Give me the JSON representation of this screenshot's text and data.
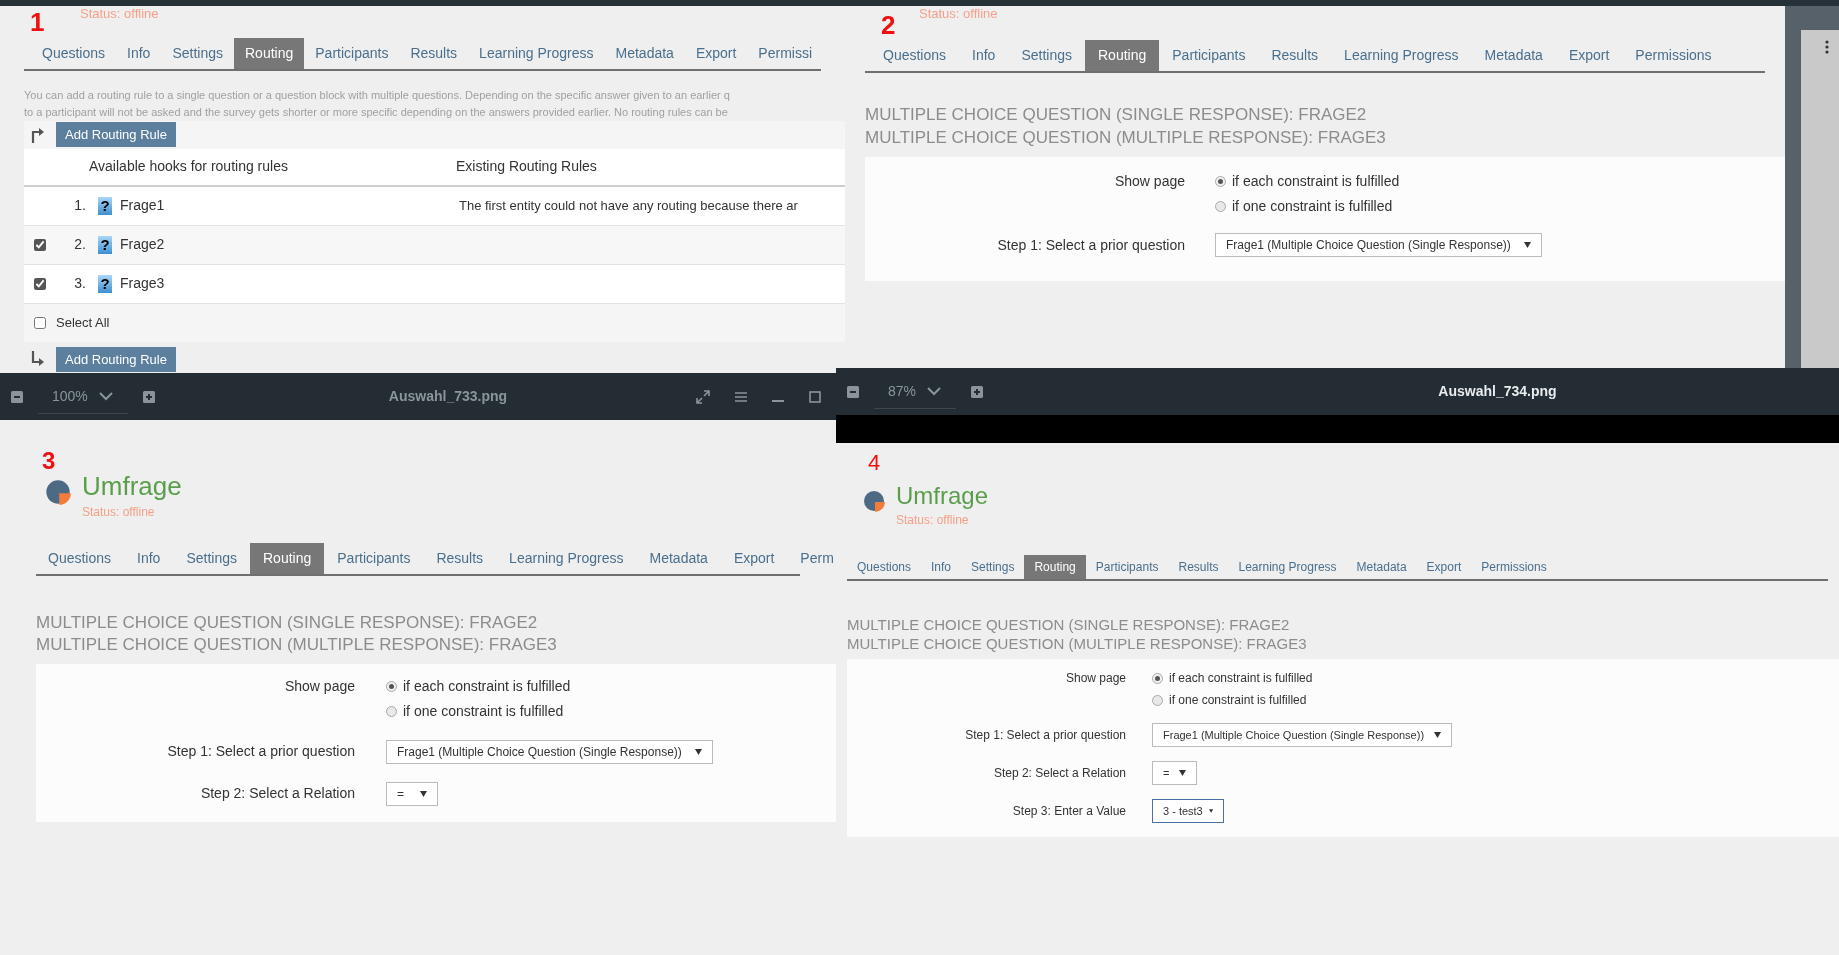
{
  "panels": [
    {
      "kind": "routing_list",
      "number": "1",
      "header": {
        "status": "Status: offline"
      },
      "tabs": [
        {
          "label": "Questions",
          "selected": false
        },
        {
          "label": "Info",
          "selected": false
        },
        {
          "label": "Settings",
          "selected": false
        },
        {
          "label": "Routing",
          "selected": true
        },
        {
          "label": "Participants",
          "selected": false
        },
        {
          "label": "Results",
          "selected": false
        },
        {
          "label": "Learning Progress",
          "selected": false
        },
        {
          "label": "Metadata",
          "selected": false
        },
        {
          "label": "Export",
          "selected": false
        },
        {
          "label": "Permissi",
          "selected": false
        }
      ],
      "intro": [
        "You can add a routing rule to a single question or a question block with multiple questions. Depending on the specific answer given to an earlier q",
        "to a participant will not be asked and the survey gets shorter or more specific depending on the answers provided earlier. No routing rules can be"
      ],
      "add_button": "Add Routing Rule",
      "columns": [
        "Available hooks for routing rules",
        "Existing Routing Rules"
      ],
      "rows": [
        {
          "kind": "fixed",
          "index": "1.",
          "icon": "?",
          "name": "Frage1",
          "rule": "The first entity could not have any routing because there ar"
        },
        {
          "kind": "selectable",
          "checked": true,
          "index": "2.",
          "icon": "?",
          "name": "Frage2"
        },
        {
          "kind": "selectable",
          "checked": true,
          "index": "3.",
          "icon": "?",
          "name": "Frage3"
        }
      ],
      "select_all": {
        "label": "Select All",
        "checked": false
      },
      "add_button_bottom": "Add Routing Rule"
    },
    {
      "kind": "routing_form",
      "number": "2",
      "header": {
        "status": "Status: offline"
      },
      "tabs": [
        {
          "label": "Questions",
          "selected": false
        },
        {
          "label": "Info",
          "selected": false
        },
        {
          "label": "Settings",
          "selected": false
        },
        {
          "label": "Routing",
          "selected": true
        },
        {
          "label": "Participants",
          "selected": false
        },
        {
          "label": "Results",
          "selected": false
        },
        {
          "label": "Learning Progress",
          "selected": false
        },
        {
          "label": "Metadata",
          "selected": false
        },
        {
          "label": "Export",
          "selected": false
        },
        {
          "label": "Permissions",
          "selected": false
        }
      ],
      "headings": [
        "MULTIPLE CHOICE QUESTION (SINGLE RESPONSE): FRAGE2",
        "MULTIPLE CHOICE QUESTION (MULTIPLE RESPONSE): FRAGE3"
      ],
      "show_page": {
        "label": "Show page",
        "options": [
          {
            "label": "if each constraint is fulfilled",
            "selected": true
          },
          {
            "label": "if one constraint is fulfilled",
            "selected": false
          }
        ]
      },
      "steps": [
        {
          "label": "Step 1: Select a prior question",
          "value": "Frage1 (Multiple Choice Question (Single Response))",
          "focused": false
        }
      ]
    },
    {
      "kind": "routing_form",
      "number": "3",
      "viewer": {
        "zoom": "100%",
        "file": "Auswahl_733.png"
      },
      "header": {
        "title": "Umfrage",
        "status": "Status: offline"
      },
      "tabs": [
        {
          "label": "Questions",
          "selected": false
        },
        {
          "label": "Info",
          "selected": false
        },
        {
          "label": "Settings",
          "selected": false
        },
        {
          "label": "Routing",
          "selected": true
        },
        {
          "label": "Participants",
          "selected": false
        },
        {
          "label": "Results",
          "selected": false
        },
        {
          "label": "Learning Progress",
          "selected": false
        },
        {
          "label": "Metadata",
          "selected": false
        },
        {
          "label": "Export",
          "selected": false
        },
        {
          "label": "Perm",
          "selected": false
        }
      ],
      "headings": [
        "MULTIPLE CHOICE QUESTION (SINGLE RESPONSE): FRAGE2",
        "MULTIPLE CHOICE QUESTION (MULTIPLE RESPONSE): FRAGE3"
      ],
      "show_page": {
        "label": "Show page",
        "options": [
          {
            "label": "if each constraint is fulfilled",
            "selected": true
          },
          {
            "label": "if one constraint is fulfilled",
            "selected": false
          }
        ]
      },
      "steps": [
        {
          "label": "Step 1: Select a prior question",
          "value": "Frage1 (Multiple Choice Question (Single Response))",
          "focused": false
        },
        {
          "label": "Step 2: Select a Relation",
          "value": "=",
          "focused": false
        }
      ]
    },
    {
      "kind": "routing_form",
      "number": "4",
      "viewer": {
        "zoom": "87%",
        "file": "Auswahl_734.png"
      },
      "header": {
        "title": "Umfrage",
        "status": "Status: offline"
      },
      "tabs": [
        {
          "label": "Questions",
          "selected": false
        },
        {
          "label": "Info",
          "selected": false
        },
        {
          "label": "Settings",
          "selected": false
        },
        {
          "label": "Routing",
          "selected": true
        },
        {
          "label": "Participants",
          "selected": false
        },
        {
          "label": "Results",
          "selected": false
        },
        {
          "label": "Learning Progress",
          "selected": false
        },
        {
          "label": "Metadata",
          "selected": false
        },
        {
          "label": "Export",
          "selected": false
        },
        {
          "label": "Permissions",
          "selected": false
        }
      ],
      "headings": [
        "MULTIPLE CHOICE QUESTION (SINGLE RESPONSE): FRAGE2",
        "MULTIPLE CHOICE QUESTION (MULTIPLE RESPONSE): FRAGE3"
      ],
      "show_page": {
        "label": "Show page",
        "options": [
          {
            "label": "if each constraint is fulfilled",
            "selected": true
          },
          {
            "label": "if one constraint is fulfilled",
            "selected": false
          }
        ]
      },
      "steps": [
        {
          "label": "Step 1: Select a prior question",
          "value": "Frage1 (Multiple Choice Question (Single Response))",
          "focused": false
        },
        {
          "label": "Step 2: Select a Relation",
          "value": "=",
          "focused": false
        },
        {
          "label": "Step 3: Enter a Value",
          "value": "3 - test3",
          "focused": true
        }
      ]
    }
  ]
}
